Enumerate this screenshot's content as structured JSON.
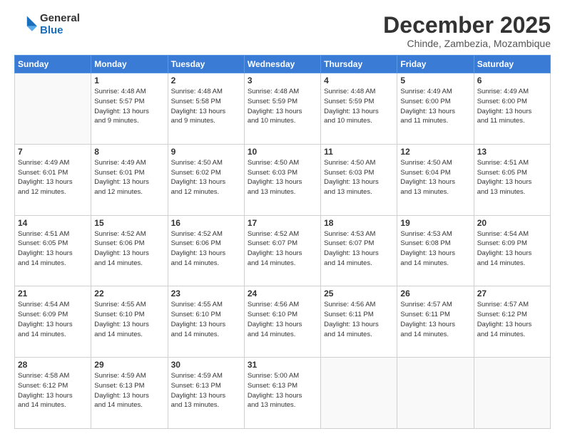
{
  "logo": {
    "general": "General",
    "blue": "Blue"
  },
  "title": "December 2025",
  "subtitle": "Chinde, Zambezia, Mozambique",
  "days_of_week": [
    "Sunday",
    "Monday",
    "Tuesday",
    "Wednesday",
    "Thursday",
    "Friday",
    "Saturday"
  ],
  "weeks": [
    [
      {
        "day": "",
        "info": ""
      },
      {
        "day": "1",
        "info": "Sunrise: 4:48 AM\nSunset: 5:57 PM\nDaylight: 13 hours\nand 9 minutes."
      },
      {
        "day": "2",
        "info": "Sunrise: 4:48 AM\nSunset: 5:58 PM\nDaylight: 13 hours\nand 9 minutes."
      },
      {
        "day": "3",
        "info": "Sunrise: 4:48 AM\nSunset: 5:59 PM\nDaylight: 13 hours\nand 10 minutes."
      },
      {
        "day": "4",
        "info": "Sunrise: 4:48 AM\nSunset: 5:59 PM\nDaylight: 13 hours\nand 10 minutes."
      },
      {
        "day": "5",
        "info": "Sunrise: 4:49 AM\nSunset: 6:00 PM\nDaylight: 13 hours\nand 11 minutes."
      },
      {
        "day": "6",
        "info": "Sunrise: 4:49 AM\nSunset: 6:00 PM\nDaylight: 13 hours\nand 11 minutes."
      }
    ],
    [
      {
        "day": "7",
        "info": "Sunrise: 4:49 AM\nSunset: 6:01 PM\nDaylight: 13 hours\nand 12 minutes."
      },
      {
        "day": "8",
        "info": "Sunrise: 4:49 AM\nSunset: 6:01 PM\nDaylight: 13 hours\nand 12 minutes."
      },
      {
        "day": "9",
        "info": "Sunrise: 4:50 AM\nSunset: 6:02 PM\nDaylight: 13 hours\nand 12 minutes."
      },
      {
        "day": "10",
        "info": "Sunrise: 4:50 AM\nSunset: 6:03 PM\nDaylight: 13 hours\nand 13 minutes."
      },
      {
        "day": "11",
        "info": "Sunrise: 4:50 AM\nSunset: 6:03 PM\nDaylight: 13 hours\nand 13 minutes."
      },
      {
        "day": "12",
        "info": "Sunrise: 4:50 AM\nSunset: 6:04 PM\nDaylight: 13 hours\nand 13 minutes."
      },
      {
        "day": "13",
        "info": "Sunrise: 4:51 AM\nSunset: 6:05 PM\nDaylight: 13 hours\nand 13 minutes."
      }
    ],
    [
      {
        "day": "14",
        "info": "Sunrise: 4:51 AM\nSunset: 6:05 PM\nDaylight: 13 hours\nand 14 minutes."
      },
      {
        "day": "15",
        "info": "Sunrise: 4:52 AM\nSunset: 6:06 PM\nDaylight: 13 hours\nand 14 minutes."
      },
      {
        "day": "16",
        "info": "Sunrise: 4:52 AM\nSunset: 6:06 PM\nDaylight: 13 hours\nand 14 minutes."
      },
      {
        "day": "17",
        "info": "Sunrise: 4:52 AM\nSunset: 6:07 PM\nDaylight: 13 hours\nand 14 minutes."
      },
      {
        "day": "18",
        "info": "Sunrise: 4:53 AM\nSunset: 6:07 PM\nDaylight: 13 hours\nand 14 minutes."
      },
      {
        "day": "19",
        "info": "Sunrise: 4:53 AM\nSunset: 6:08 PM\nDaylight: 13 hours\nand 14 minutes."
      },
      {
        "day": "20",
        "info": "Sunrise: 4:54 AM\nSunset: 6:09 PM\nDaylight: 13 hours\nand 14 minutes."
      }
    ],
    [
      {
        "day": "21",
        "info": "Sunrise: 4:54 AM\nSunset: 6:09 PM\nDaylight: 13 hours\nand 14 minutes."
      },
      {
        "day": "22",
        "info": "Sunrise: 4:55 AM\nSunset: 6:10 PM\nDaylight: 13 hours\nand 14 minutes."
      },
      {
        "day": "23",
        "info": "Sunrise: 4:55 AM\nSunset: 6:10 PM\nDaylight: 13 hours\nand 14 minutes."
      },
      {
        "day": "24",
        "info": "Sunrise: 4:56 AM\nSunset: 6:10 PM\nDaylight: 13 hours\nand 14 minutes."
      },
      {
        "day": "25",
        "info": "Sunrise: 4:56 AM\nSunset: 6:11 PM\nDaylight: 13 hours\nand 14 minutes."
      },
      {
        "day": "26",
        "info": "Sunrise: 4:57 AM\nSunset: 6:11 PM\nDaylight: 13 hours\nand 14 minutes."
      },
      {
        "day": "27",
        "info": "Sunrise: 4:57 AM\nSunset: 6:12 PM\nDaylight: 13 hours\nand 14 minutes."
      }
    ],
    [
      {
        "day": "28",
        "info": "Sunrise: 4:58 AM\nSunset: 6:12 PM\nDaylight: 13 hours\nand 14 minutes."
      },
      {
        "day": "29",
        "info": "Sunrise: 4:59 AM\nSunset: 6:13 PM\nDaylight: 13 hours\nand 14 minutes."
      },
      {
        "day": "30",
        "info": "Sunrise: 4:59 AM\nSunset: 6:13 PM\nDaylight: 13 hours\nand 13 minutes."
      },
      {
        "day": "31",
        "info": "Sunrise: 5:00 AM\nSunset: 6:13 PM\nDaylight: 13 hours\nand 13 minutes."
      },
      {
        "day": "",
        "info": ""
      },
      {
        "day": "",
        "info": ""
      },
      {
        "day": "",
        "info": ""
      }
    ]
  ]
}
